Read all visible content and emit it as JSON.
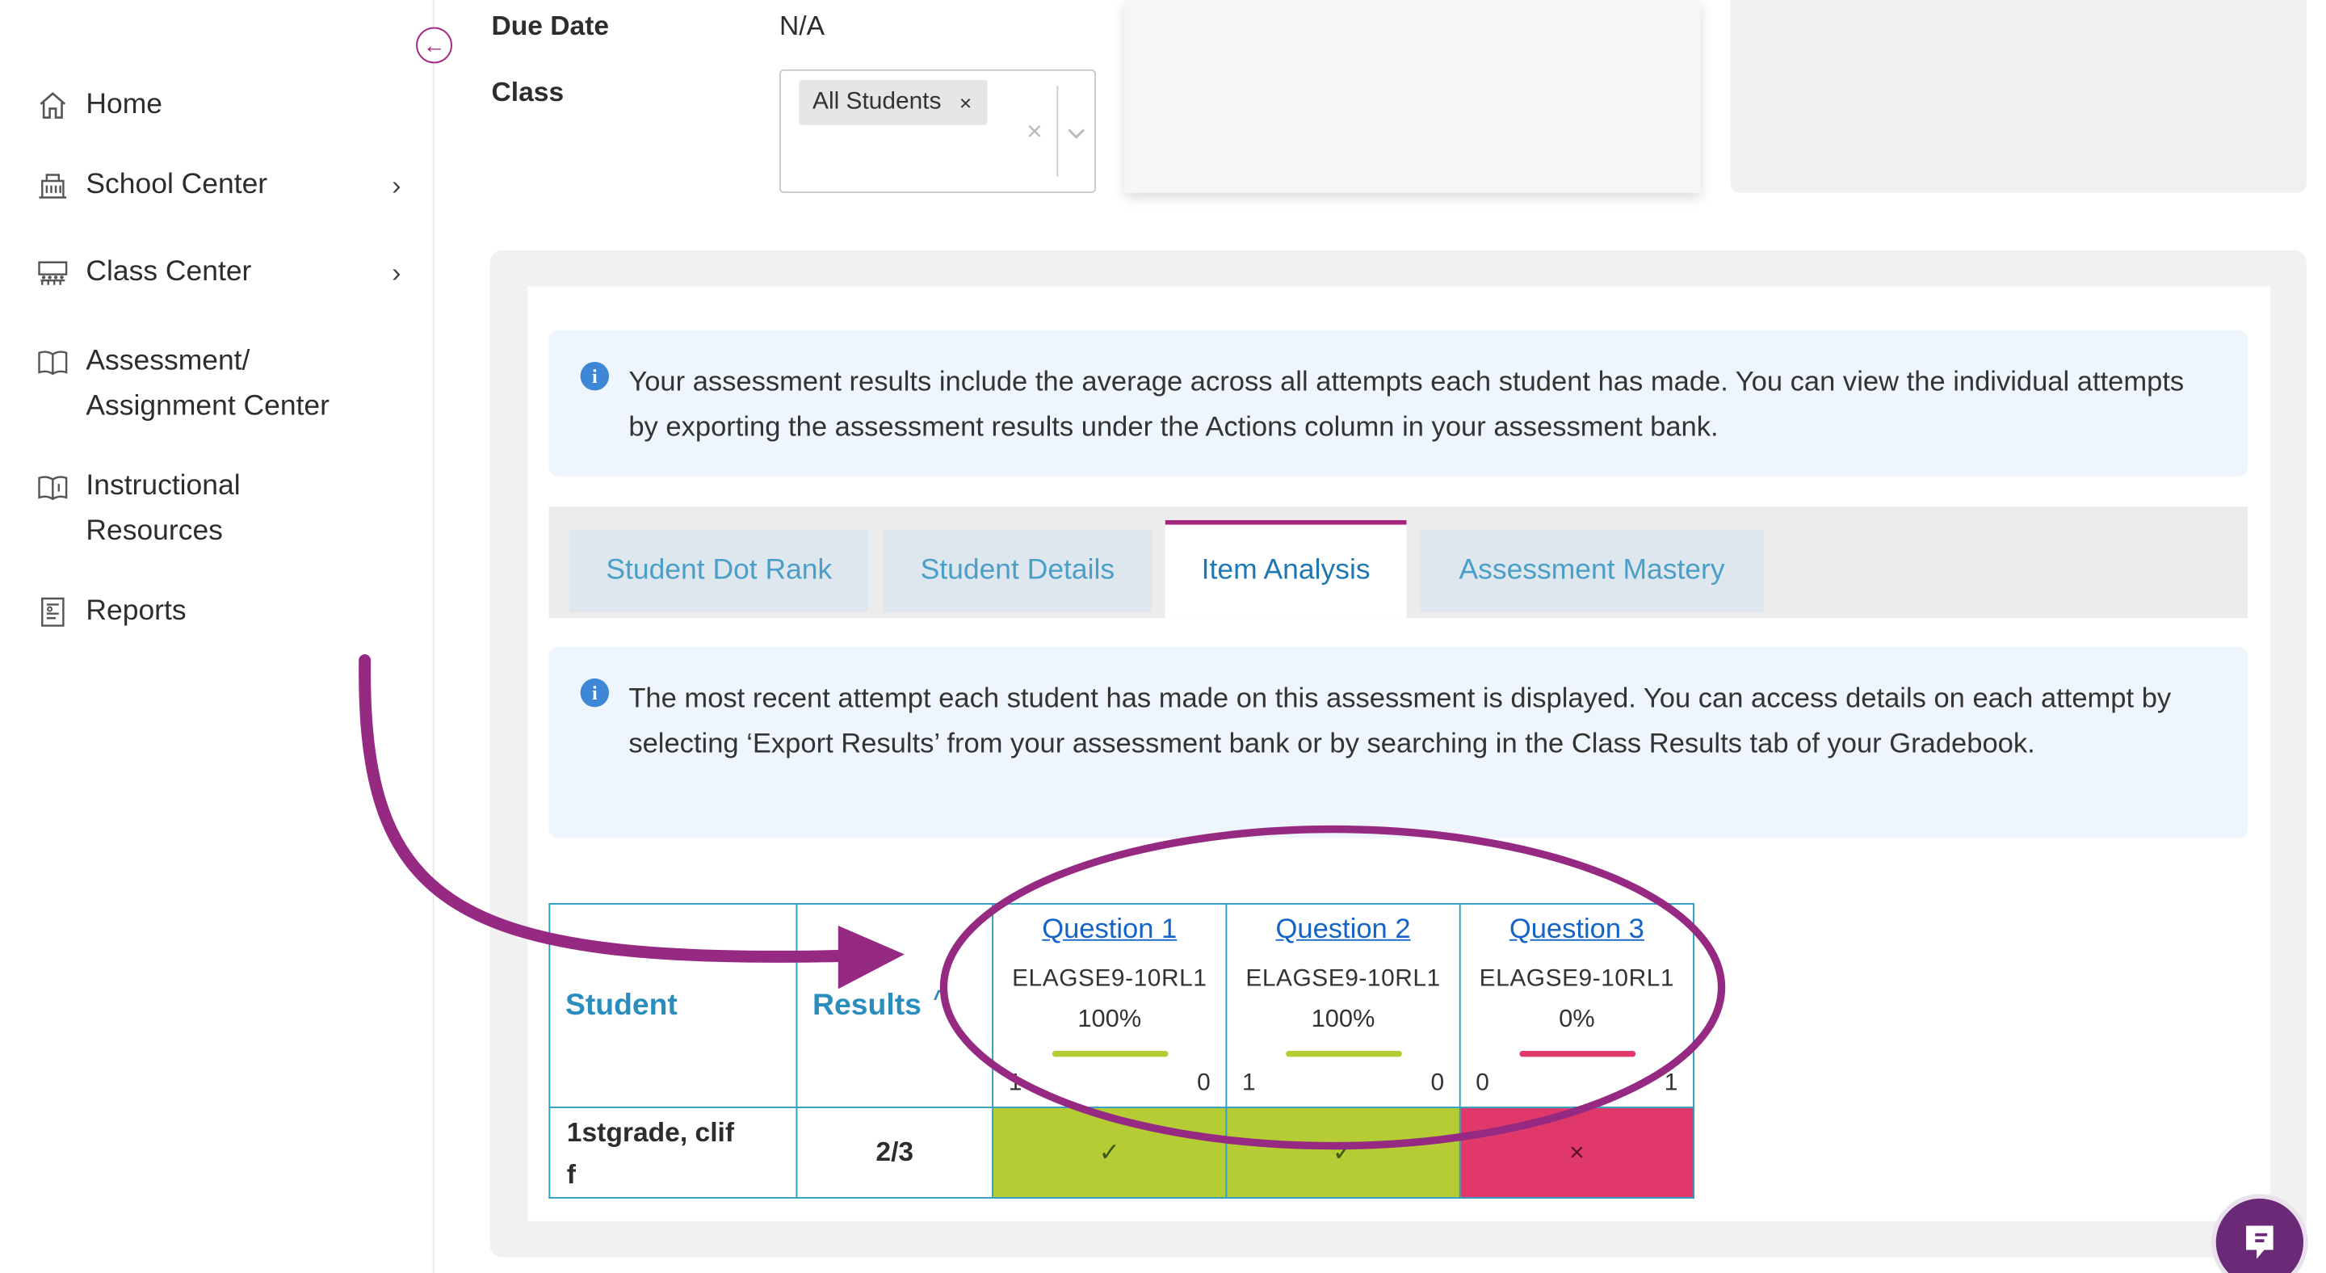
{
  "sidebar": {
    "items": [
      {
        "label": "Home"
      },
      {
        "label": "School Center"
      },
      {
        "label": "Class Center"
      },
      {
        "label": "Assessment/",
        "label2": "Assignment Center"
      },
      {
        "label": "Instructional",
        "label2": "Resources"
      },
      {
        "label": "Reports"
      }
    ]
  },
  "fields": {
    "due_date_label": "Due Date",
    "due_date_value": "N/A",
    "class_label": "Class",
    "class_chip": "All Students",
    "chip_remove": "×",
    "clear": "×"
  },
  "info": {
    "results_note": "Your assessment results include the average across all attempts each student has made. You can view the individual attempts by exporting the assessment results under the Actions column in your assessment bank.",
    "recent_note": "The most recent attempt each student has made on this assessment is displayed. You can access details on each attempt by selecting ‘Export Results’ from your assessment bank or by searching in the Class Results tab of your Gradebook.",
    "icon_glyph": "i"
  },
  "tabs": [
    {
      "label": "Student Dot Rank"
    },
    {
      "label": "Student Details"
    },
    {
      "label": "Item Analysis"
    },
    {
      "label": "Assessment Mastery"
    }
  ],
  "table": {
    "student_header": "Student",
    "results_header": "Results",
    "sort_glyph": "^",
    "questions": [
      {
        "title": "Question 1",
        "standard": "ELAGSE9-10RL1",
        "percent": "100%",
        "left": "1",
        "right": "0",
        "color": "#b5cc34"
      },
      {
        "title": "Question 2",
        "standard": "ELAGSE9-10RL1",
        "percent": "100%",
        "left": "1",
        "right": "0",
        "color": "#b5cc34"
      },
      {
        "title": "Question 3",
        "standard": "ELAGSE9-10RL1",
        "percent": "0%",
        "left": "0",
        "right": "1",
        "color": "#e0386a"
      }
    ],
    "rows": [
      {
        "student": "1stgrade, clif",
        "student2": "f",
        "results": "2/3",
        "cells": [
          {
            "mark": "✓",
            "color": "#b5cc34"
          },
          {
            "mark": "✓",
            "color": "#b5cc34"
          },
          {
            "mark": "×",
            "color": "#e0386a"
          }
        ]
      }
    ]
  },
  "colors": {
    "accent": "#a3237e",
    "link": "#1464c8",
    "correct": "#b5cc34",
    "incorrect": "#e0386a"
  }
}
